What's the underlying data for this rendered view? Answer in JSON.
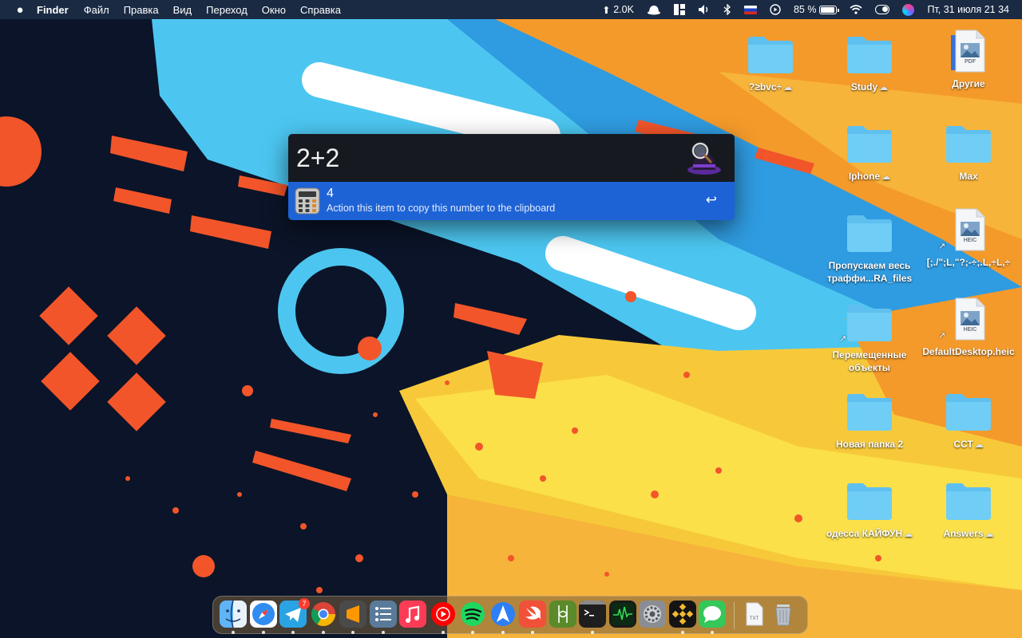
{
  "menubar": {
    "app_name": "Finder",
    "menus": [
      "Файл",
      "Правка",
      "Вид",
      "Переход",
      "Окно",
      "Справка"
    ],
    "network_speed": "2.0K",
    "battery_percent": "85 %",
    "datetime": "Пт, 31 июля  21 34"
  },
  "alfred": {
    "query": "2+2",
    "result_title": "4",
    "result_subtitle": "Action this item to copy this number to the clipboard",
    "return_key": "↩"
  },
  "desktop": [
    {
      "label": "?≥bvc÷",
      "kind": "folder",
      "cloud": true
    },
    {
      "label": "Study",
      "kind": "folder",
      "cloud": true
    },
    {
      "label": "Другие",
      "kind": "pdf",
      "cloud": false,
      "badge": "PDF"
    },
    {
      "label": "Iphone",
      "kind": "folder",
      "cloud": true
    },
    {
      "label": "Max",
      "kind": "folder",
      "cloud": false
    },
    {
      "label": "Пропускаем весь траффи...RA_files",
      "kind": "folder",
      "cloud": false
    },
    {
      "label": "[;./\";L,\"?;-÷;.L,÷L,÷",
      "kind": "heic",
      "cloud": false,
      "badge": "HEIC"
    },
    {
      "label": "Перемещенные объекты",
      "kind": "folder",
      "cloud": false
    },
    {
      "label": "DefaultDesktop.heic",
      "kind": "heic",
      "cloud": false,
      "badge": "HEIC"
    },
    {
      "label": "Новая папка 2",
      "kind": "folder",
      "cloud": false
    },
    {
      "label": "ССТ",
      "kind": "folder",
      "cloud": true
    },
    {
      "label": "одесса КАЙФУН",
      "kind": "folder",
      "cloud": true
    },
    {
      "label": "Answers",
      "kind": "folder",
      "cloud": true
    }
  ],
  "dock": {
    "apps": [
      "Finder",
      "Safari",
      "Telegram",
      "Chrome",
      "Sublime Text",
      "Tasks",
      "Music",
      "YouTube Music",
      "Spotify",
      "Copilot",
      "Swift Playgrounds",
      "Battery",
      "Terminal",
      "Activity Monitor",
      "System Preferences",
      "Binance",
      "Messages"
    ],
    "telegram_badge": "7",
    "document_label": "TXT"
  }
}
